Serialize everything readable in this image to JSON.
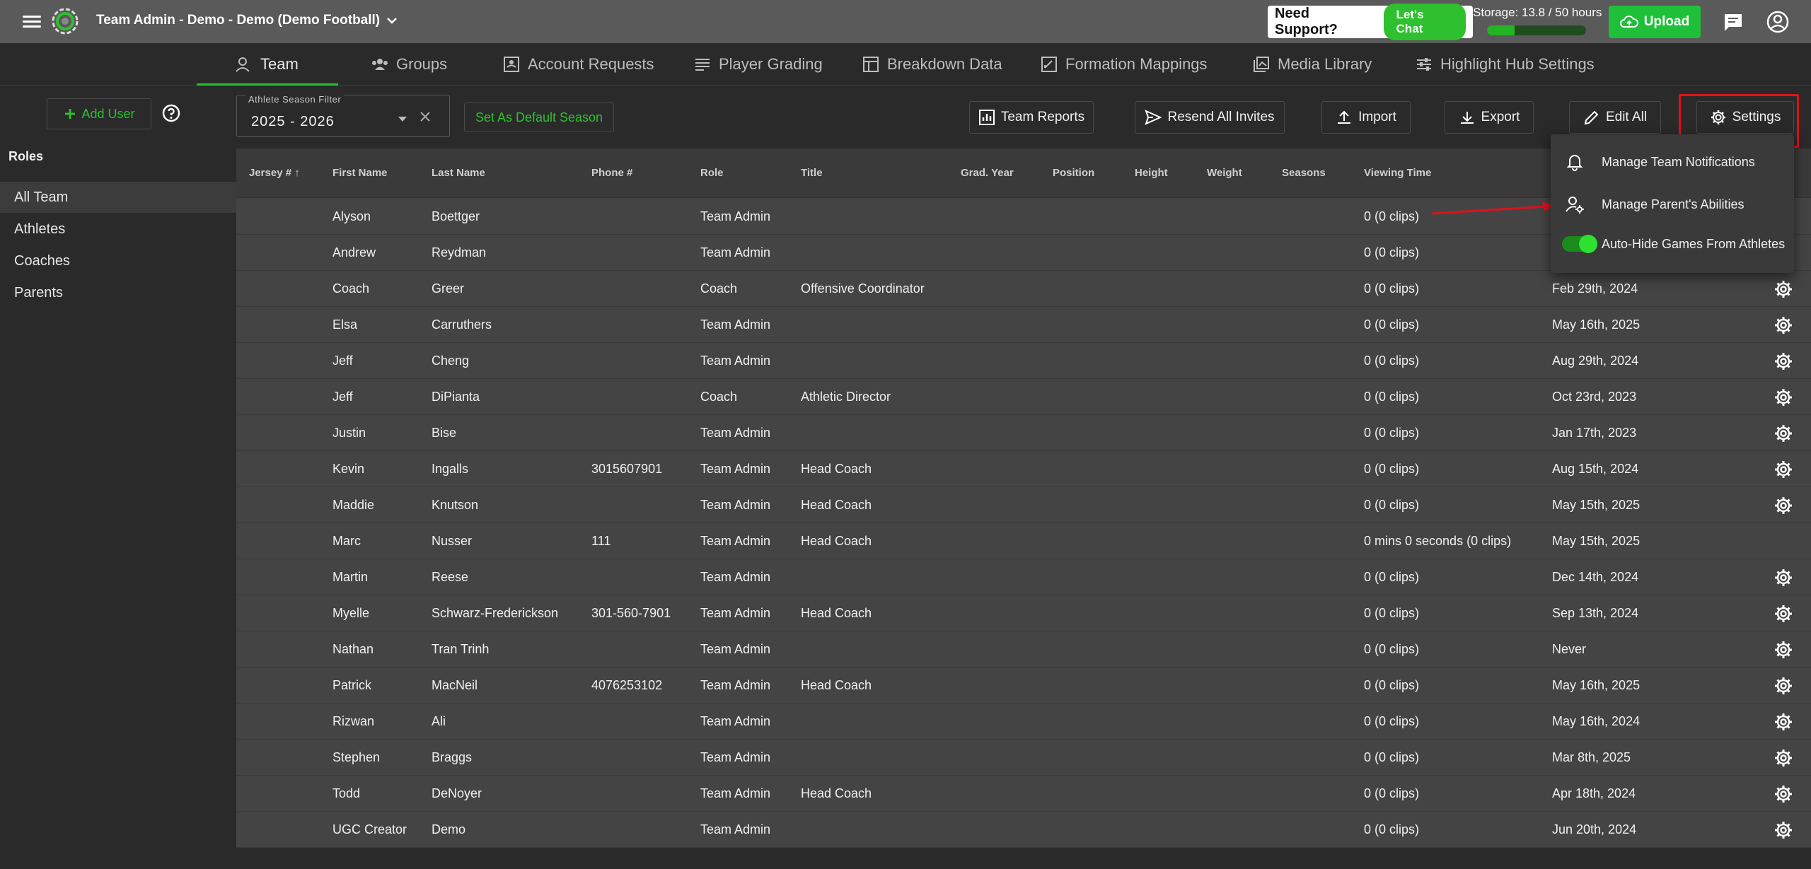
{
  "header": {
    "team_title": "Team Admin - Demo - Demo (Demo Football)",
    "support_label": "Need Support?",
    "chat_label": "Let's Chat",
    "storage_text": "Storage: 13.8 / 50 hours",
    "storage_fraction": 0.28,
    "upload_label": "Upload"
  },
  "tabs": [
    {
      "label": "Team",
      "icon": "person-icon"
    },
    {
      "label": "Groups",
      "icon": "group-icon"
    },
    {
      "label": "Account Requests",
      "icon": "inbox-icon"
    },
    {
      "label": "Player Grading",
      "icon": "list-icon"
    },
    {
      "label": "Breakdown Data",
      "icon": "table-icon"
    },
    {
      "label": "Formation Mappings",
      "icon": "draw-icon"
    },
    {
      "label": "Media Library",
      "icon": "media-icon"
    },
    {
      "label": "Highlight Hub Settings",
      "icon": "sliders-icon"
    }
  ],
  "sidebar": {
    "add_user_label": "Add User",
    "roles_heading": "Roles",
    "roles": [
      "All Team",
      "Athletes",
      "Coaches",
      "Parents"
    ]
  },
  "toolbar": {
    "season_filter_label": "Athlete Season Filter",
    "season_filter_value": "2025 - 2026",
    "set_default_label": "Set As Default Season",
    "team_reports_label": "Team Reports",
    "resend_invites_label": "Resend All Invites",
    "import_label": "Import",
    "export_label": "Export",
    "edit_all_label": "Edit All",
    "settings_label": "Settings"
  },
  "table": {
    "columns": [
      "Jersey #",
      "First Name",
      "Last Name",
      "Phone #",
      "Role",
      "Title",
      "Grad. Year",
      "Position",
      "Height",
      "Weight",
      "Seasons",
      "Viewing Time"
    ],
    "rows": [
      {
        "first": "Alyson",
        "last": "Boettger",
        "phone": "",
        "role": "Team Admin",
        "title": "",
        "viewing": "0 (0 clips)",
        "last_active": "",
        "gear": false
      },
      {
        "first": "Andrew",
        "last": "Reydman",
        "phone": "",
        "role": "Team Admin",
        "title": "",
        "viewing": "0 (0 clips)",
        "last_active": "",
        "gear": false
      },
      {
        "first": "Coach",
        "last": "Greer",
        "phone": "",
        "role": "Coach",
        "title": "Offensive Coordinator",
        "viewing": "0 (0 clips)",
        "last_active": "Feb 29th, 2024",
        "gear": true
      },
      {
        "first": "Elsa",
        "last": "Carruthers",
        "phone": "",
        "role": "Team Admin",
        "title": "",
        "viewing": "0 (0 clips)",
        "last_active": "May 16th, 2025",
        "gear": true
      },
      {
        "first": "Jeff",
        "last": "Cheng",
        "phone": "",
        "role": "Team Admin",
        "title": "",
        "viewing": "0 (0 clips)",
        "last_active": "Aug 29th, 2024",
        "gear": true
      },
      {
        "first": "Jeff",
        "last": "DiPianta",
        "phone": "",
        "role": "Coach",
        "title": "Athletic Director",
        "viewing": "0 (0 clips)",
        "last_active": "Oct 23rd, 2023",
        "gear": true
      },
      {
        "first": "Justin",
        "last": "Bise",
        "phone": "",
        "role": "Team Admin",
        "title": "",
        "viewing": "0 (0 clips)",
        "last_active": "Jan 17th, 2023",
        "gear": true
      },
      {
        "first": "Kevin",
        "last": "Ingalls",
        "phone": "3015607901",
        "role": "Team Admin",
        "title": "Head Coach",
        "viewing": "0 (0 clips)",
        "last_active": "Aug 15th, 2024",
        "gear": true
      },
      {
        "first": "Maddie",
        "last": "Knutson",
        "phone": "",
        "role": "Team Admin",
        "title": "Head Coach",
        "viewing": "0 (0 clips)",
        "last_active": "May 15th, 2025",
        "gear": true
      },
      {
        "first": "Marc",
        "last": "Nusser",
        "phone": "111",
        "role": "Team Admin",
        "title": "Head Coach",
        "viewing": "0 mins 0 seconds (0 clips)",
        "last_active": "May 15th, 2025",
        "gear": false
      },
      {
        "first": "Martin",
        "last": "Reese",
        "phone": "",
        "role": "Team Admin",
        "title": "",
        "viewing": "0 (0 clips)",
        "last_active": "Dec 14th, 2024",
        "gear": true
      },
      {
        "first": "Myelle",
        "last": "Schwarz-Frederickson",
        "phone": "301-560-7901",
        "role": "Team Admin",
        "title": "Head Coach",
        "viewing": "0 (0 clips)",
        "last_active": "Sep 13th, 2024",
        "gear": true
      },
      {
        "first": "Nathan",
        "last": "Tran Trinh",
        "phone": "",
        "role": "Team Admin",
        "title": "",
        "viewing": "0 (0 clips)",
        "last_active": "Never",
        "gear": true
      },
      {
        "first": "Patrick",
        "last": "MacNeil",
        "phone": "4076253102",
        "role": "Team Admin",
        "title": "Head Coach",
        "viewing": "0 (0 clips)",
        "last_active": "May 16th, 2025",
        "gear": true
      },
      {
        "first": "Rizwan",
        "last": "Ali",
        "phone": "",
        "role": "Team Admin",
        "title": "",
        "viewing": "0 (0 clips)",
        "last_active": "May 16th, 2024",
        "gear": true
      },
      {
        "first": "Stephen",
        "last": "Braggs",
        "phone": "",
        "role": "Team Admin",
        "title": "",
        "viewing": "0 (0 clips)",
        "last_active": "Mar 8th, 2025",
        "gear": true
      },
      {
        "first": "Todd",
        "last": "DeNoyer",
        "phone": "",
        "role": "Team Admin",
        "title": "Head Coach",
        "viewing": "0 (0 clips)",
        "last_active": "Apr 18th, 2024",
        "gear": true
      },
      {
        "first": "UGC Creator",
        "last": "Demo",
        "phone": "",
        "role": "Team Admin",
        "title": "",
        "viewing": "0 (0 clips)",
        "last_active": "Jun 20th, 2024",
        "gear": true
      }
    ]
  },
  "settings_menu": {
    "items": [
      {
        "label": "Manage Team Notifications",
        "icon": "bell-icon"
      },
      {
        "label": "Manage Parent's Abilities",
        "icon": "person-gear-icon"
      },
      {
        "label": "Auto-Hide Games From Athletes",
        "icon": "toggle",
        "enabled": true
      }
    ]
  },
  "colors": {
    "accent_green": "#2ec02e",
    "highlight_red": "#e0101a",
    "topbar": "#5a5a5a",
    "background": "#2a2a2a",
    "table_row": "#444444"
  }
}
